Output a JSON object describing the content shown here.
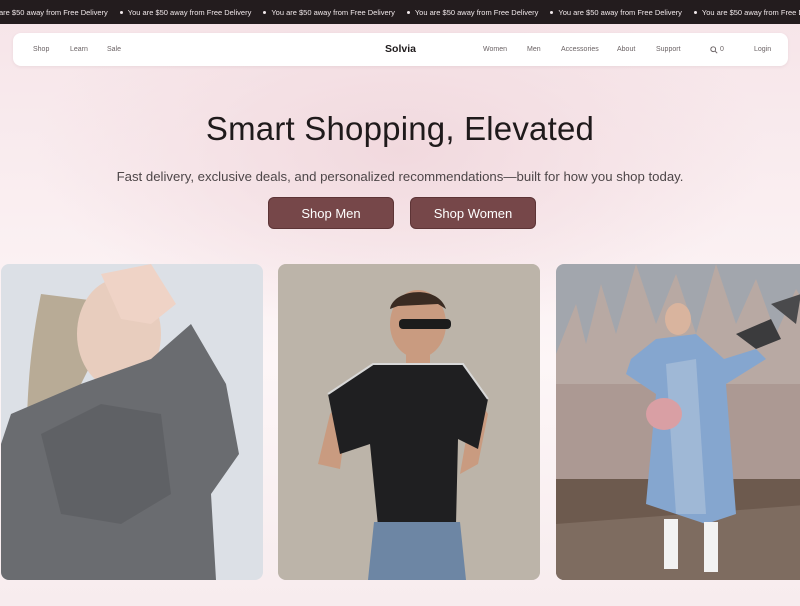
{
  "announcement": {
    "text": "You are $50 away from Free  Delivery",
    "first_partial": "are $50 away from Free  Delivery"
  },
  "nav": {
    "left_links": [
      "Shop",
      "Learn",
      "Sale"
    ],
    "brand": "Solvia",
    "right_links": [
      "Women",
      "Men",
      "Accessories",
      "About",
      "Support"
    ],
    "cart_count": "0",
    "login": "Login"
  },
  "hero": {
    "title": "Smart Shopping, Elevated",
    "subtitle": "Fast delivery, exclusive deals, and personalized recommendations—built for how you shop today.",
    "buttons": [
      "Shop Men",
      "Shop Women"
    ]
  },
  "colors": {
    "accent": "#764749",
    "marquee_bg": "#231c1e",
    "page_bg": "#fbf1f3"
  },
  "icons": {
    "search": "search-icon"
  }
}
